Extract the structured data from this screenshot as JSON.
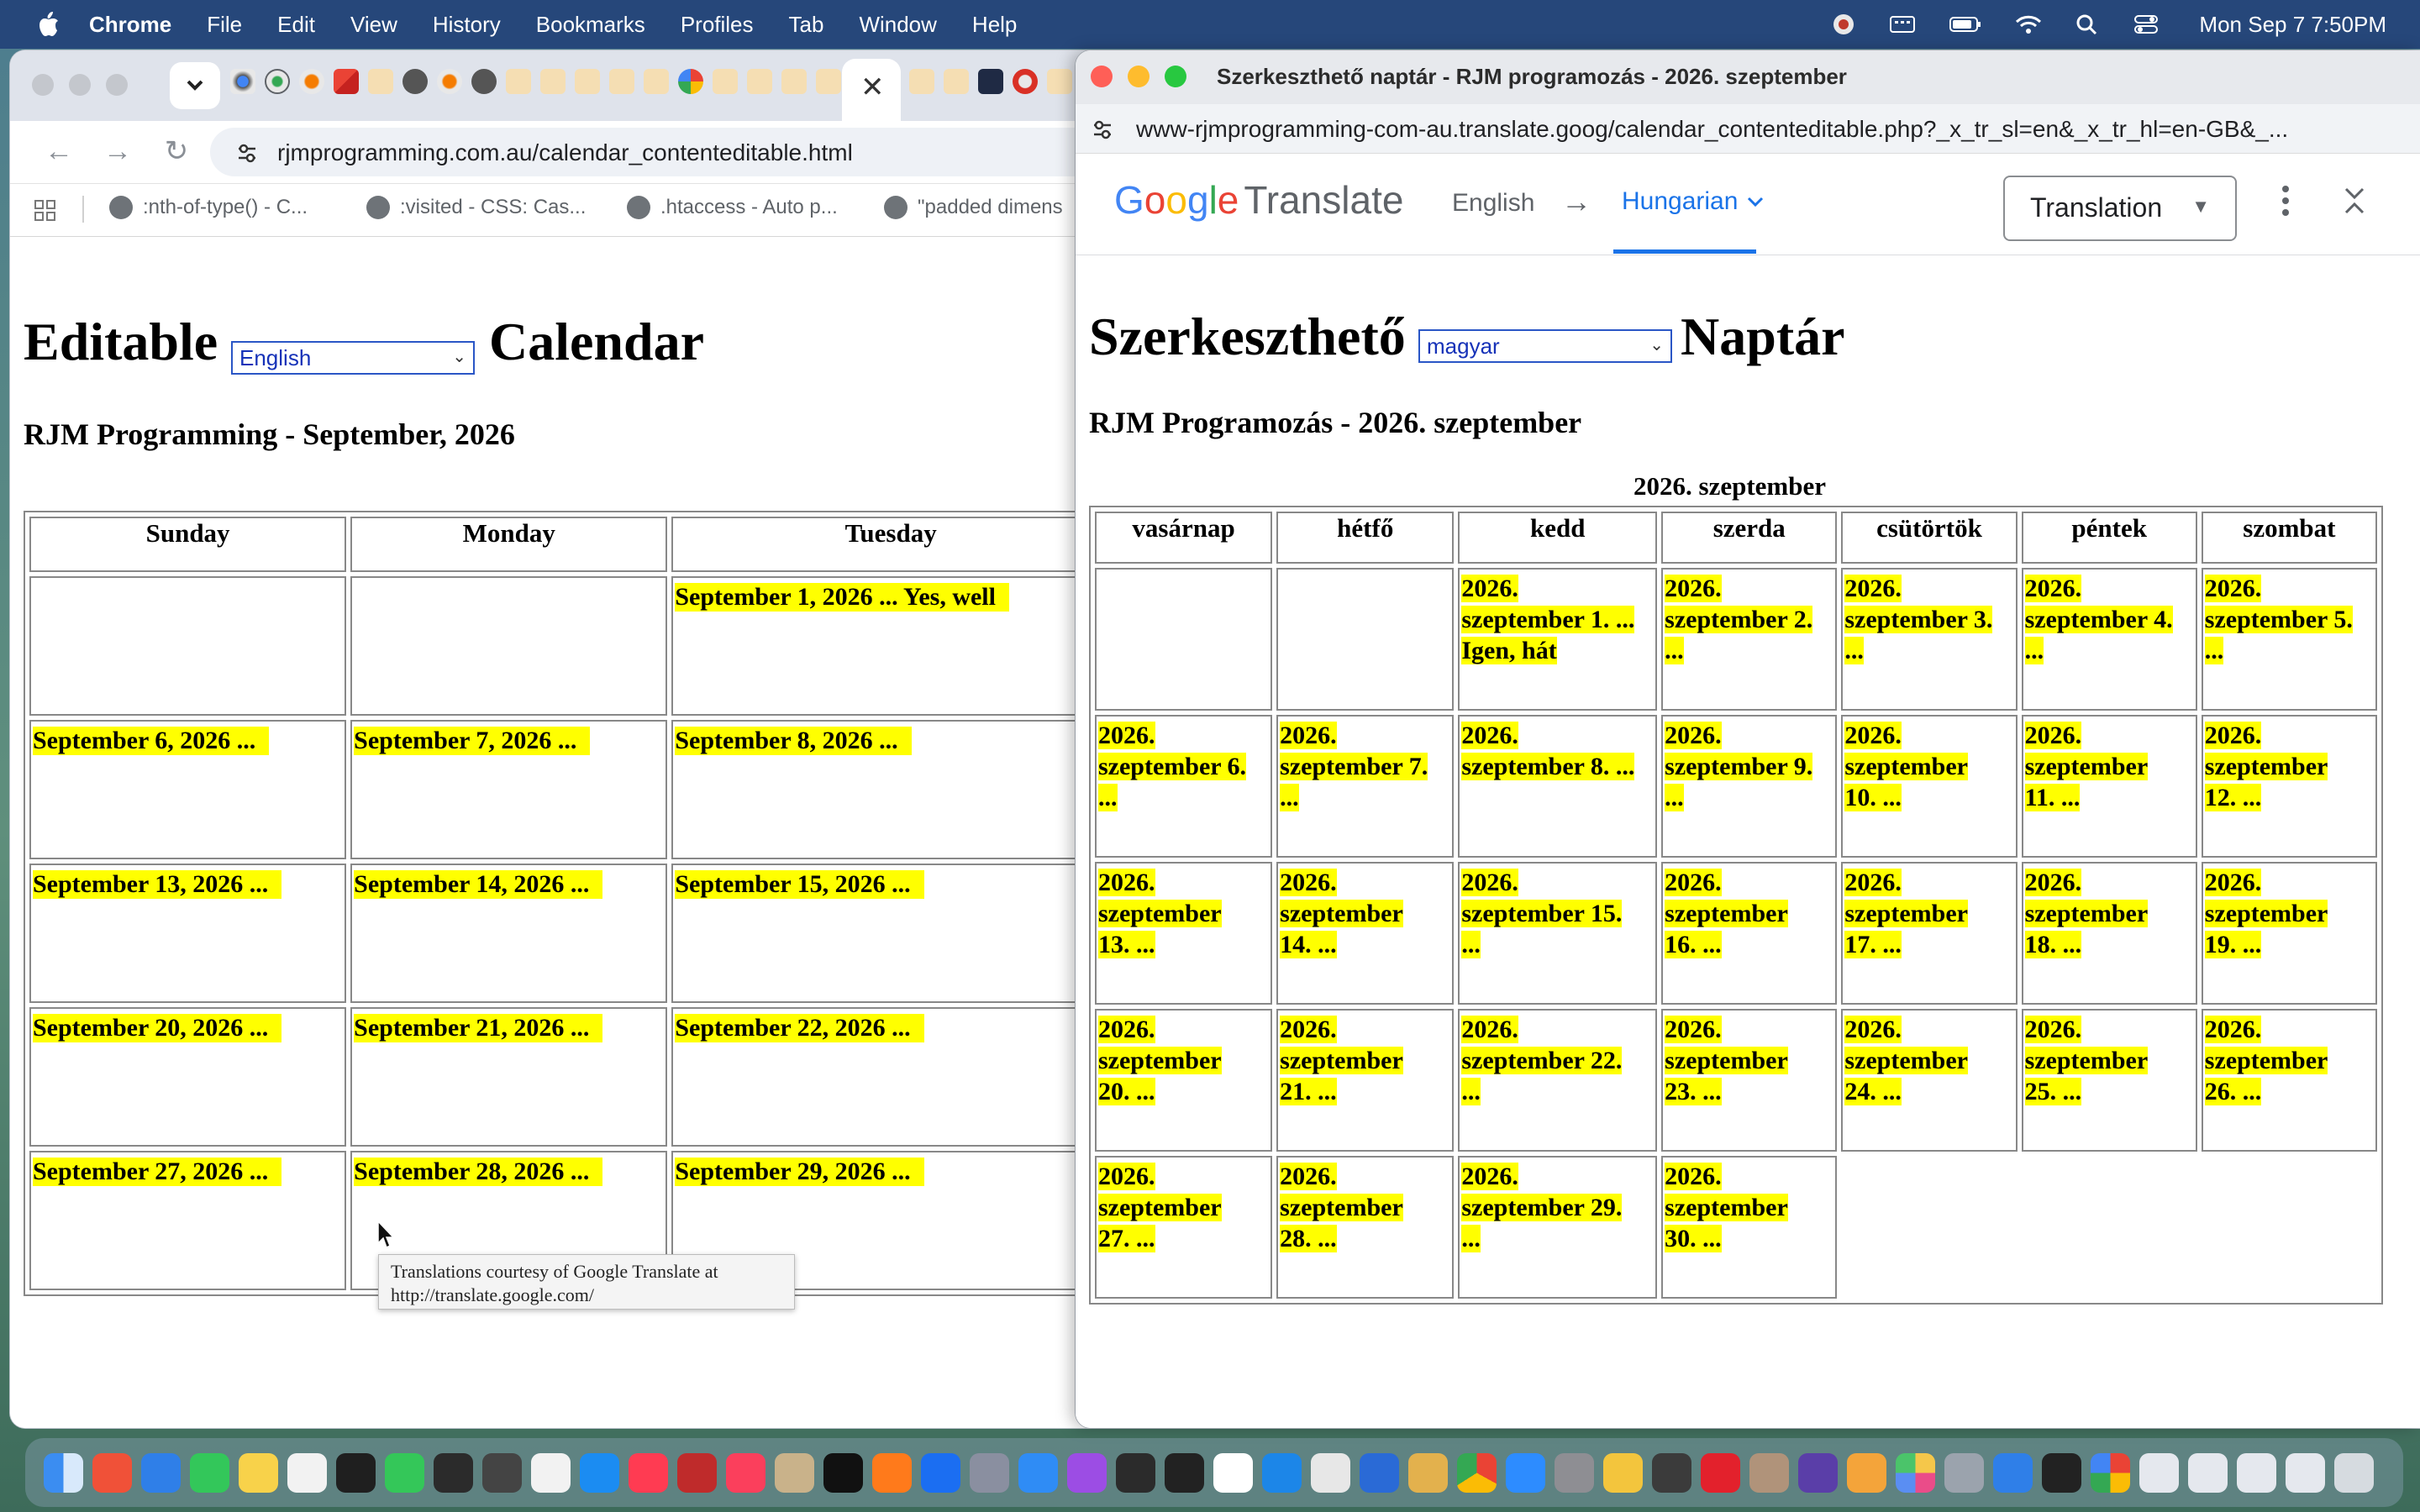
{
  "menubar": {
    "app_name": "Chrome",
    "items": [
      "File",
      "Edit",
      "View",
      "History",
      "Bookmarks",
      "Profiles",
      "Tab",
      "Window",
      "Help"
    ],
    "clock": "Mon Sep 7  7:50PM"
  },
  "left_window": {
    "url": "rjmprogramming.com.au/calendar_contenteditable.html",
    "bookmarks": [
      ":nth-of-type() - C...",
      ":visited - CSS: Cas...",
      ".htaccess - Auto p...",
      "\"padded dimens"
    ],
    "page": {
      "heading_left": "Editable",
      "heading_right": "Calendar",
      "language_select": "English",
      "subtitle": "RJM Programming - September, 2026",
      "weekdays": [
        "Sunday",
        "Monday",
        "Tuesday"
      ],
      "rows": [
        [
          "",
          "",
          "September 1, 2026 ... Yes, well"
        ],
        [
          "September 6, 2026 ...",
          "September 7, 2026 ...",
          "September 8, 2026 ..."
        ],
        [
          "September 13, 2026 ...",
          "September 14, 2026 ...",
          "September 15, 2026 ..."
        ],
        [
          "September 20, 2026 ...",
          "September 21, 2026 ...",
          "September 22, 2026 ..."
        ],
        [
          "September 27, 2026 ...",
          "September 28, 2026 ...",
          "September 29, 2026 ..."
        ]
      ],
      "tooltip_line1": "Translations courtesy of Google Translate at",
      "tooltip_line2": "http://translate.google.com/"
    }
  },
  "right_window": {
    "title": "Szerkeszthető naptár - RJM programozás - 2026. szeptember",
    "url": "www-rjmprogramming-com-au.translate.goog/calendar_contenteditable.php?_x_tr_sl=en&_x_tr_hl=en-GB&_...",
    "translate_bar": {
      "brand": "Google",
      "product": "Translate",
      "source_lang": "English",
      "arrow": "→",
      "target_lang": "Hungarian",
      "mode": "Translation"
    },
    "page": {
      "heading_left": "Szerkeszthető",
      "heading_right": "Naptár",
      "language_select": "magyar",
      "subtitle": "RJM Programozás - 2026. szeptember",
      "caption": "2026. szeptember",
      "weekdays": [
        "vasárnap",
        "hétfő",
        "kedd",
        "szerda",
        "csütörtök",
        "péntek",
        "szombat"
      ],
      "rows": [
        [
          [],
          [],
          [
            "2026.",
            "szeptember 1. ...",
            "Igen, hát"
          ],
          [
            "2026.",
            "szeptember 2.",
            "..."
          ],
          [
            "2026.",
            "szeptember 3.",
            "..."
          ],
          [
            "2026.",
            "szeptember 4.",
            "..."
          ],
          [
            "2026.",
            "szeptember 5.",
            "..."
          ]
        ],
        [
          [
            "2026.",
            "szeptember 6.",
            "..."
          ],
          [
            "2026.",
            "szeptember 7.",
            "..."
          ],
          [
            "2026.",
            "szeptember 8. ...",
            ""
          ],
          [
            "2026.",
            "szeptember 9.",
            "..."
          ],
          [
            "2026.",
            "szeptember",
            "10. ..."
          ],
          [
            "2026.",
            "szeptember",
            "11. ..."
          ],
          [
            "2026.",
            "szeptember",
            "12. ..."
          ]
        ],
        [
          [
            "2026.",
            "szeptember",
            "13. ..."
          ],
          [
            "2026.",
            "szeptember",
            "14. ..."
          ],
          [
            "2026.",
            "szeptember 15.",
            "..."
          ],
          [
            "2026.",
            "szeptember",
            "16. ..."
          ],
          [
            "2026.",
            "szeptember",
            "17. ..."
          ],
          [
            "2026.",
            "szeptember",
            "18. ..."
          ],
          [
            "2026.",
            "szeptember",
            "19. ..."
          ]
        ],
        [
          [
            "2026.",
            "szeptember",
            "20. ..."
          ],
          [
            "2026.",
            "szeptember",
            "21. ..."
          ],
          [
            "2026.",
            "szeptember 22.",
            "..."
          ],
          [
            "2026.",
            "szeptember",
            "23. ..."
          ],
          [
            "2026.",
            "szeptember",
            "24. ..."
          ],
          [
            "2026.",
            "szeptember",
            "25. ..."
          ],
          [
            "2026.",
            "szeptember",
            "26. ..."
          ]
        ],
        [
          [
            "2026.",
            "szeptember",
            "27. ..."
          ],
          [
            "2026.",
            "szeptember",
            "28. ..."
          ],
          [
            "2026.",
            "szeptember 29.",
            "..."
          ],
          [
            "2026.",
            "szeptember",
            "30. ..."
          ]
        ]
      ]
    }
  },
  "colors": {
    "highlight": "#ffff00",
    "menubar": "#26477a",
    "link_blue": "#1a73e8"
  }
}
